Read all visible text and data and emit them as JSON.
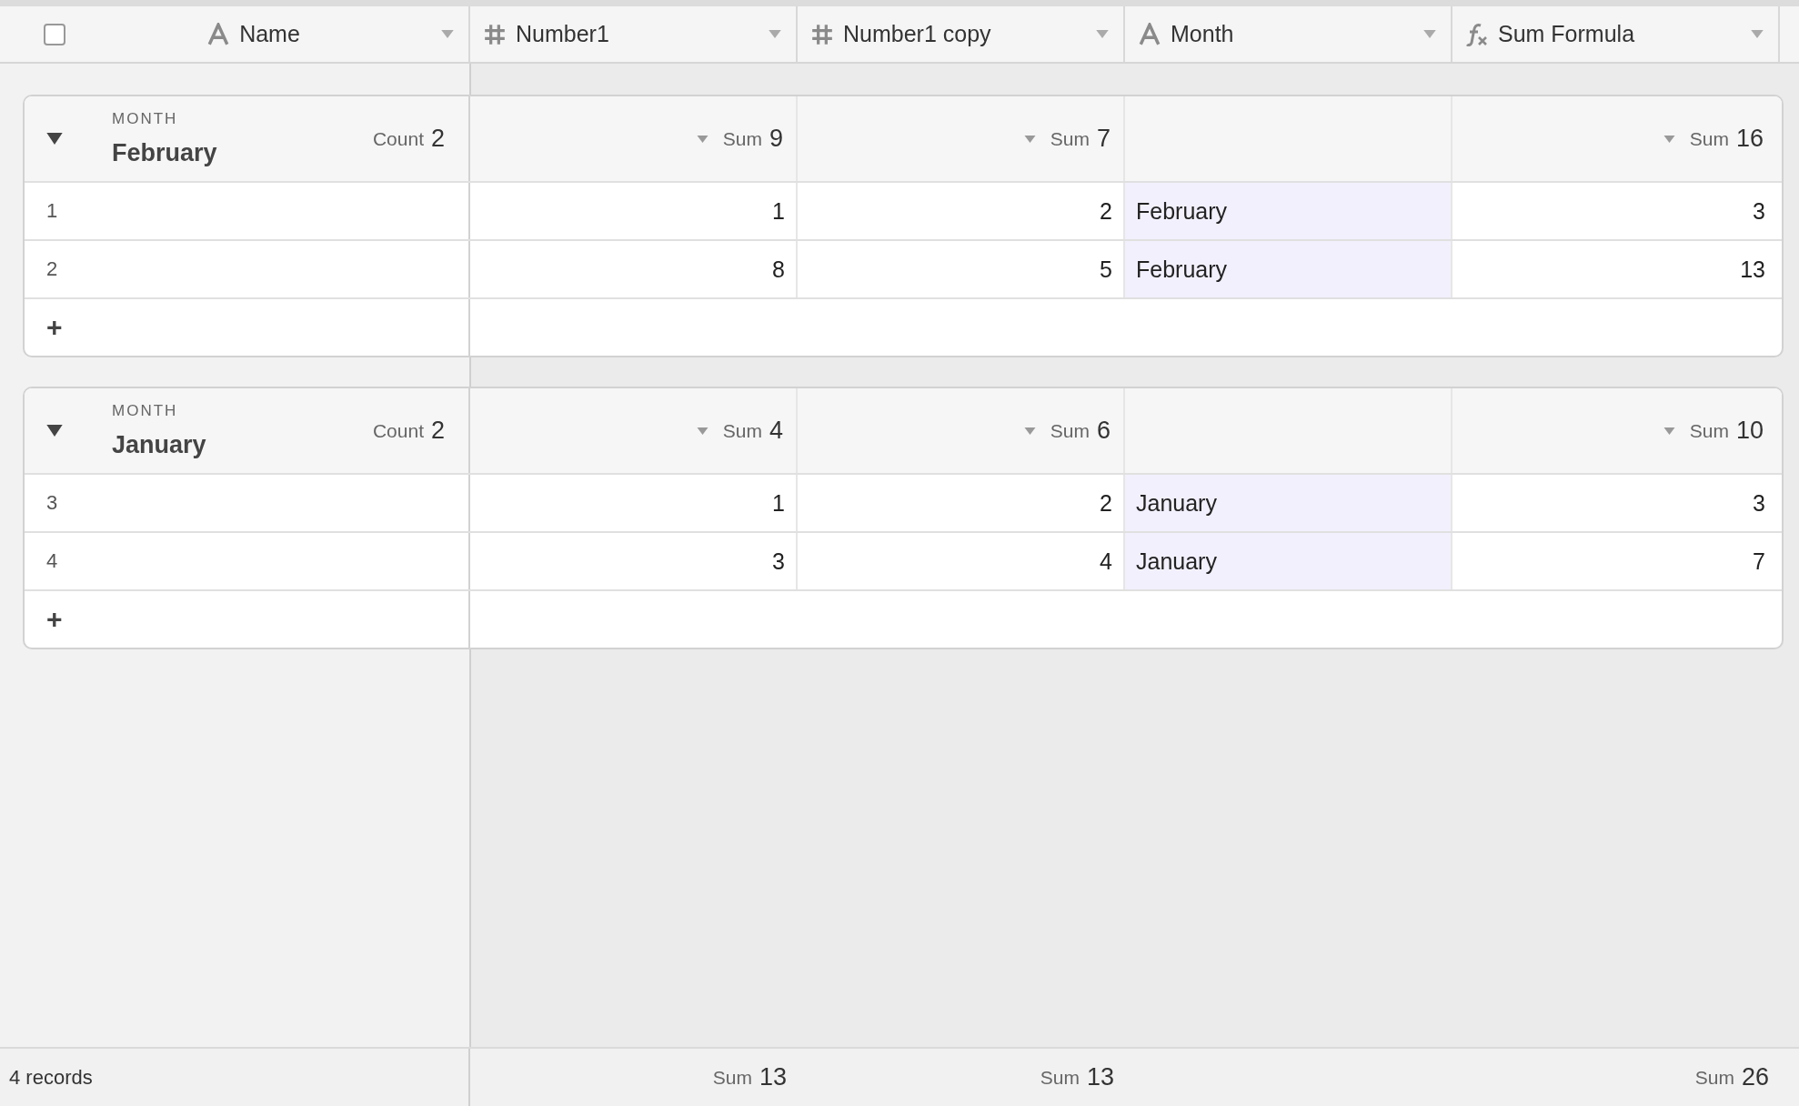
{
  "header": {
    "select_all": {
      "checked": false
    },
    "columns": [
      {
        "label": "Name",
        "kind": "text"
      },
      {
        "label": "Number1",
        "kind": "number"
      },
      {
        "label": "Number1 copy",
        "kind": "number"
      },
      {
        "label": "Month",
        "kind": "text"
      },
      {
        "label": "Sum Formula",
        "kind": "formula"
      }
    ]
  },
  "groups": [
    {
      "field_label": "MONTH",
      "title": "February",
      "expanded": true,
      "count_label": "Count",
      "count": "2",
      "summaries": [
        {
          "kind": "sum",
          "label": "Sum",
          "value": "9"
        },
        {
          "kind": "sum",
          "label": "Sum",
          "value": "7"
        },
        {
          "kind": "none"
        },
        {
          "kind": "sum",
          "label": "Sum",
          "value": "16"
        }
      ],
      "rows": [
        {
          "number": "1",
          "cells": [
            {
              "value": "1",
              "highlighted": false
            },
            {
              "value": "2",
              "highlighted": false
            },
            {
              "value": "February",
              "highlighted": true
            },
            {
              "value": "3",
              "highlighted": false
            }
          ]
        },
        {
          "number": "2",
          "cells": [
            {
              "value": "8",
              "highlighted": false
            },
            {
              "value": "5",
              "highlighted": false
            },
            {
              "value": "February",
              "highlighted": true
            },
            {
              "value": "13",
              "highlighted": false
            }
          ]
        }
      ],
      "add_label": "+"
    },
    {
      "field_label": "MONTH",
      "title": "January",
      "expanded": true,
      "count_label": "Count",
      "count": "2",
      "summaries": [
        {
          "kind": "sum",
          "label": "Sum",
          "value": "4"
        },
        {
          "kind": "sum",
          "label": "Sum",
          "value": "6"
        },
        {
          "kind": "none"
        },
        {
          "kind": "sum",
          "label": "Sum",
          "value": "10"
        }
      ],
      "rows": [
        {
          "number": "3",
          "cells": [
            {
              "value": "1",
              "highlighted": false
            },
            {
              "value": "2",
              "highlighted": false
            },
            {
              "value": "January",
              "highlighted": true
            },
            {
              "value": "3",
              "highlighted": false
            }
          ]
        },
        {
          "number": "4",
          "cells": [
            {
              "value": "3",
              "highlighted": false
            },
            {
              "value": "4",
              "highlighted": false
            },
            {
              "value": "January",
              "highlighted": true
            },
            {
              "value": "7",
              "highlighted": false
            }
          ]
        }
      ],
      "add_label": "+"
    }
  ],
  "footer": {
    "records": "4 records",
    "summaries": [
      {
        "kind": "sum",
        "label": "Sum",
        "value": "13"
      },
      {
        "kind": "sum",
        "label": "Sum",
        "value": "13"
      },
      {
        "kind": "none"
      },
      {
        "kind": "sum",
        "label": "Sum",
        "value": "26"
      }
    ]
  }
}
